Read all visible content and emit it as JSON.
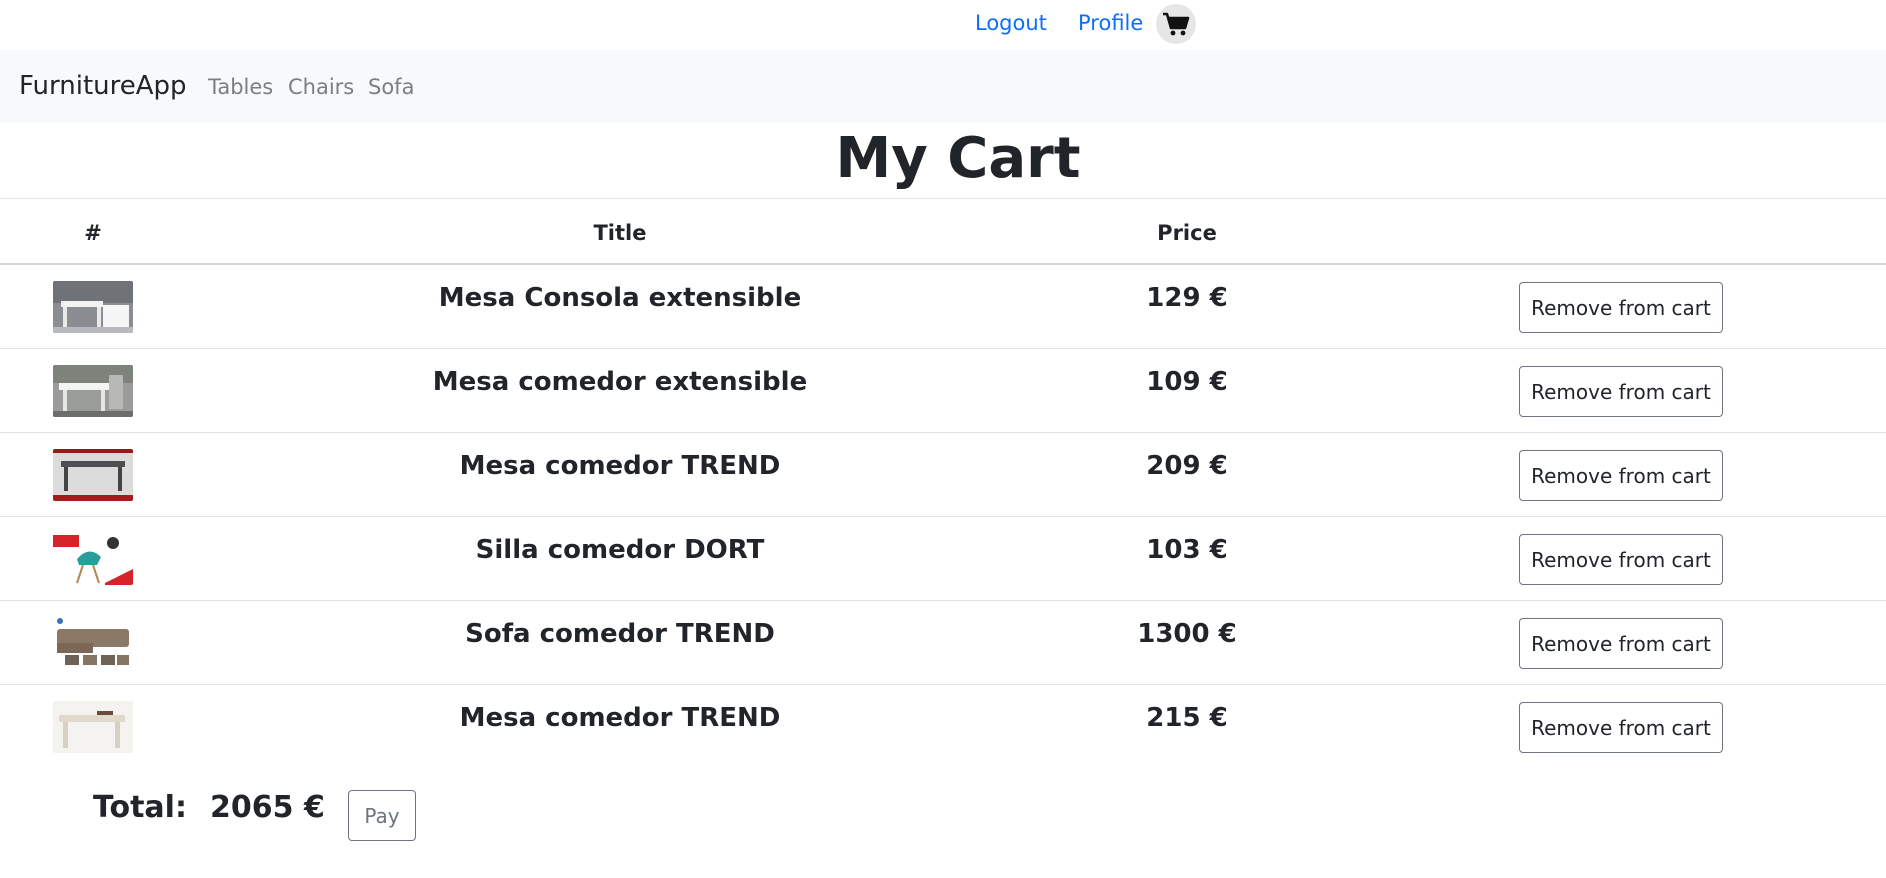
{
  "topbar": {
    "logout_label": "Logout",
    "profile_label": "Profile",
    "cart_icon": "shopping-cart-icon",
    "link_color": "#0d6efd"
  },
  "navbar": {
    "brand": "FurnitureApp",
    "links": [
      "Tables",
      "Chairs",
      "Sofa"
    ]
  },
  "page": {
    "title": "My Cart"
  },
  "table": {
    "headers": [
      "#",
      "Title",
      "Price",
      ""
    ],
    "rows": [
      {
        "thumb": "white console table photo",
        "title": "Mesa Consola extensible",
        "price": "129 €",
        "action": "Remove from cart"
      },
      {
        "thumb": "white dining table photo",
        "title": "Mesa comedor extensible",
        "price": "109 €",
        "action": "Remove from cart"
      },
      {
        "thumb": "grey table photo",
        "title": "Mesa comedor TREND",
        "price": "209 €",
        "action": "Remove from cart"
      },
      {
        "thumb": "teal chair photo",
        "title": "Silla comedor DORT",
        "price": "103 €",
        "action": "Remove from cart"
      },
      {
        "thumb": "beige sofa photo",
        "title": "Sofa comedor TREND",
        "price": "1300 €",
        "action": "Remove from cart"
      },
      {
        "thumb": "cream table photo",
        "title": "Mesa comedor TREND",
        "price": "215 €",
        "action": "Remove from cart"
      }
    ]
  },
  "summary": {
    "total_label": "Total:",
    "total_value": "2065 €",
    "pay_label": "Pay"
  }
}
